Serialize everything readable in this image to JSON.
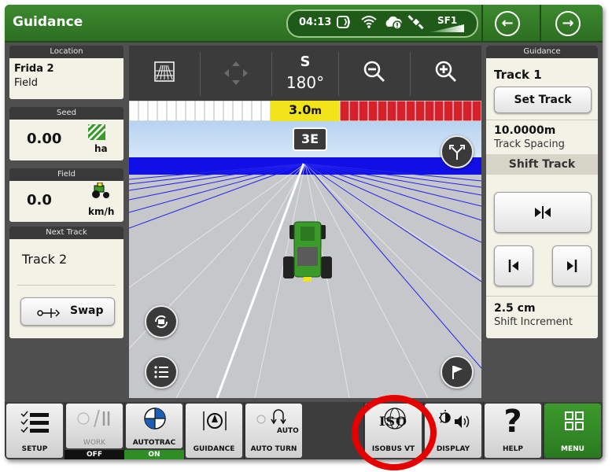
{
  "header": {
    "title": "Guidance",
    "time": "04:13",
    "sf_label": "SF1",
    "back_icon": "arrow-left-circle-icon",
    "forward_icon": "arrow-right-circle-icon"
  },
  "left_panel": {
    "location": {
      "label": "Location",
      "name": "Frida 2",
      "sub": "Field"
    },
    "seed": {
      "label": "Seed",
      "value": "0.00",
      "unit": "ha"
    },
    "field": {
      "label": "Field",
      "value": "0.0",
      "unit": "km/h"
    },
    "next_track": {
      "label": "Next Track",
      "value": "Track 2",
      "swap_label": "Swap"
    }
  },
  "view": {
    "heading_letter": "S",
    "heading_degrees": "180°",
    "offset": "3.0",
    "offset_unit": "m",
    "track_tag": "3E"
  },
  "guidance_panel": {
    "header": "Guidance",
    "track_name": "Track 1",
    "set_track_label": "Set Track",
    "spacing_value": "10.0000m",
    "spacing_label": "Track Spacing",
    "shift_track_label": "Shift Track",
    "increment_value": "2.5 cm",
    "increment_label": "Shift Increment"
  },
  "bottom_bar": {
    "setup": "SETUP",
    "work": "WORK",
    "work_status": "OFF",
    "autotrac": "AUTOTRAC",
    "autotrac_status": "ON",
    "guidance": "GUIDANCE",
    "autoturn": "AUTO TURN",
    "autoturn_icon_text": "AUTO",
    "isobus": "ISOBUS VT",
    "iso_logo": "ISO",
    "display": "DISPLAY",
    "help": "HELP",
    "menu": "MENU"
  },
  "colors": {
    "header_green": "#367d2a",
    "annotation_red": "#e60000",
    "lightbar_red": "#d6202a",
    "offset_yellow": "#f3e31a",
    "on_green": "#2f8d25"
  }
}
